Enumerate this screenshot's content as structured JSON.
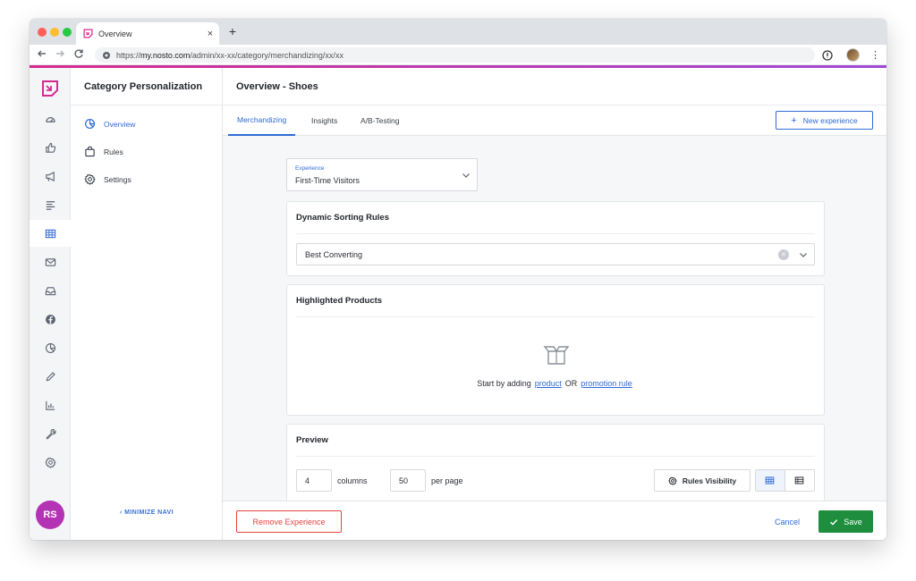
{
  "browser": {
    "tab_title": "Overview",
    "tab_close": "×",
    "new_tab": "+",
    "url_prefix": "https://",
    "url_host": "my.nosto.com",
    "url_path": "/admin/xx-xx/category/merchandizing/xx/xx"
  },
  "sidebar_rail": {
    "items": [
      {
        "icon": "dashboard-icon"
      },
      {
        "icon": "thumbs-up-icon"
      },
      {
        "icon": "megaphone-icon"
      },
      {
        "icon": "list-icon"
      },
      {
        "icon": "grid-icon",
        "active": true
      },
      {
        "icon": "mail-icon"
      },
      {
        "icon": "inbox-icon"
      },
      {
        "icon": "facebook-icon"
      },
      {
        "icon": "pie-chart-icon"
      },
      {
        "icon": "pencil-icon"
      },
      {
        "icon": "bar-chart-icon"
      },
      {
        "icon": "wrench-icon"
      },
      {
        "icon": "settings-icon"
      }
    ],
    "avatar_initials": "RS"
  },
  "subnav": {
    "title": "Category Personalization",
    "items": [
      {
        "label": "Overview",
        "icon": "pie-chart-icon",
        "active": true
      },
      {
        "label": "Rules",
        "icon": "bag-icon"
      },
      {
        "label": "Settings",
        "icon": "gear-icon"
      }
    ],
    "minimize_label": "‹ MINIMIZE NAVI"
  },
  "page": {
    "title": "Overview - Shoes",
    "tabs": [
      {
        "label": "Merchandizing",
        "active": true
      },
      {
        "label": "Insights"
      },
      {
        "label": "A/B-Testing"
      }
    ],
    "new_experience_label": "New experience"
  },
  "experience_select": {
    "label": "Experience",
    "value": "First-Time Visitors"
  },
  "sorting_card": {
    "title": "Dynamic Sorting Rules",
    "selected": "Best Converting"
  },
  "highlighted_card": {
    "title": "Highlighted Products",
    "text_before": "Start by adding",
    "link_product": "product",
    "text_or": "OR",
    "link_promotion": "promotion rule"
  },
  "preview_card": {
    "title": "Preview",
    "columns_value": "4",
    "columns_label": "columns",
    "per_page_value": "50",
    "per_page_label": "per page",
    "rules_visibility_label": "Rules Visibility"
  },
  "footer": {
    "remove_label": "Remove Experience",
    "cancel_label": "Cancel",
    "save_label": "Save"
  },
  "colors": {
    "accent_blue": "#2f6bd6",
    "save_green": "#1e8e3e",
    "remove_red": "#e0463f",
    "brand_pink": "#d72a8f",
    "avatar_purple": "#b432b4"
  }
}
